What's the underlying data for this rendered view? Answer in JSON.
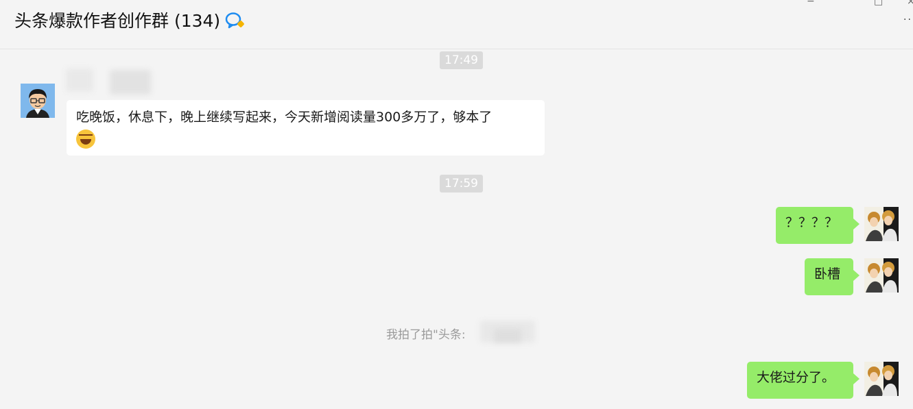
{
  "header": {
    "title": "头条爆款作者创作群 (134)",
    "min_glyph": "−",
    "max_glyph": "□",
    "close_glyph": "×",
    "more_glyph": "··"
  },
  "messages": {
    "time1": "17:49",
    "msg1_text": "吃晚饭，休息下，晚上继续写起来，今天新增阅读量300多万了，够本了",
    "time2": "17:59",
    "msg2_text": "？？？？",
    "msg3_text": "卧槽",
    "system_text": "我拍了拍\"头条:",
    "msg4_text": "大佬过分了。"
  },
  "colors": {
    "outgoing_bubble": "#95ec69",
    "incoming_bubble": "#ffffff",
    "background": "#f4f4f4",
    "time_pill": "#dadada"
  },
  "icons": {
    "chat": "chat-bubble-icon",
    "emoji": "laughing-crying-emoji"
  }
}
